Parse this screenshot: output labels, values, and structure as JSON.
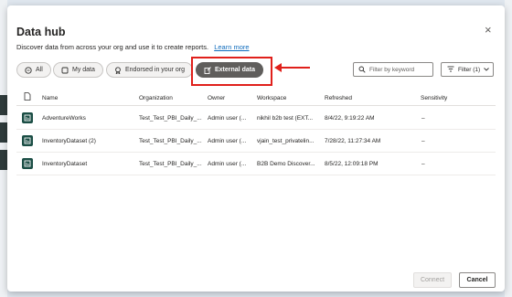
{
  "dialog": {
    "title": "Data hub",
    "subtitle": "Discover data from across your org and use it to create reports.",
    "learn_more": "Learn more",
    "close_icon": "×"
  },
  "filters": {
    "pills": [
      {
        "label": "All",
        "icon": "grid-icon",
        "active": false
      },
      {
        "label": "My data",
        "icon": "user-icon",
        "active": false
      },
      {
        "label": "Endorsed in your org",
        "icon": "badge-icon",
        "active": false
      },
      {
        "label": "External data",
        "icon": "external-icon",
        "active": true
      }
    ],
    "search_placeholder": "Filter by keyword",
    "filter_button": "Filter (1)"
  },
  "table": {
    "headers": {
      "name": "Name",
      "organization": "Organization",
      "owner": "Owner",
      "workspace": "Workspace",
      "refreshed": "Refreshed",
      "sensitivity": "Sensitivity"
    },
    "rows": [
      {
        "name": "AdventureWorks",
        "organization": "Test_Test_PBI_Daily_...",
        "owner": "Admin user (...",
        "workspace": "nikhil b2b test (EXT...",
        "refreshed": "8/4/22, 9:19:22 AM",
        "sensitivity": "–"
      },
      {
        "name": "InventoryDataset (2)",
        "organization": "Test_Test_PBI_Daily_...",
        "owner": "Admin user (...",
        "workspace": "vjain_test_privatelin...",
        "refreshed": "7/28/22, 11:27:34 AM",
        "sensitivity": "–"
      },
      {
        "name": "InventoryDataset",
        "organization": "Test_Test_PBI_Daily_...",
        "owner": "Admin user (...",
        "workspace": "B2B Demo Discover...",
        "refreshed": "8/5/22, 12:09:18 PM",
        "sensitivity": "–"
      }
    ]
  },
  "footer": {
    "connect": "Connect",
    "cancel": "Cancel"
  },
  "colors": {
    "highlight": "#e0201b",
    "active_pill": "#605e5c",
    "dataset_icon": "#1b4e45",
    "link": "#0f6cbd"
  }
}
